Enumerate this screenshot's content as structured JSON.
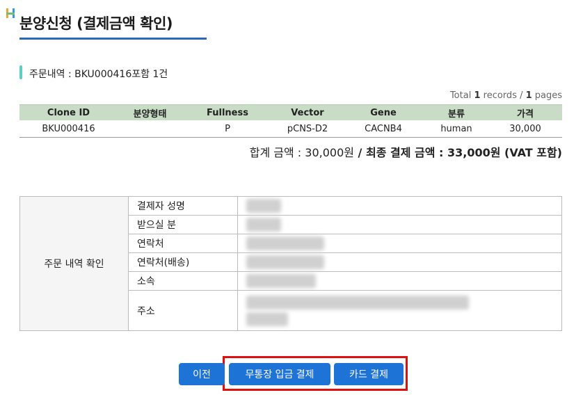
{
  "page": {
    "title": "분양신청 (결제금액 확인)"
  },
  "order": {
    "summary": "주문내역 : BKU000416포함 1건"
  },
  "pagination": {
    "prefix": "Total ",
    "records": "1",
    "mid": " records / ",
    "pages": "1",
    "suffix": " pages"
  },
  "items": {
    "columns": [
      "Clone ID",
      "분양형태",
      "Fullness",
      "Vector",
      "Gene",
      "분류",
      "가격"
    ],
    "rows": [
      [
        "BKU000416",
        "",
        "P",
        "pCNS-D2",
        "CACNB4",
        "human",
        "30,000"
      ]
    ]
  },
  "totals": {
    "subtotal_label": "합계 금액 : ",
    "subtotal_value": "30,000원",
    "separator": " / ",
    "final_label": "최종 결제 금액 : ",
    "final_value": "33,000원",
    "vat_note": " (VAT 포함)"
  },
  "confirm": {
    "section_label": "주문 내역 확인",
    "fields": [
      {
        "label": "결제자 성명"
      },
      {
        "label": "받으실 분"
      },
      {
        "label": "연락처"
      },
      {
        "label": "연락처(배송)"
      },
      {
        "label": "소속"
      },
      {
        "label": "주소"
      }
    ]
  },
  "buttons": {
    "prev": "이전",
    "bank_transfer": "무통장 입금 결제",
    "card": "카드 결제"
  },
  "colors": {
    "accent": "#2c66c0",
    "button": "#1d73d6",
    "table_header": "#c8dcc6",
    "highlight": "#e01010",
    "order_bar": "#5ad0c0"
  }
}
